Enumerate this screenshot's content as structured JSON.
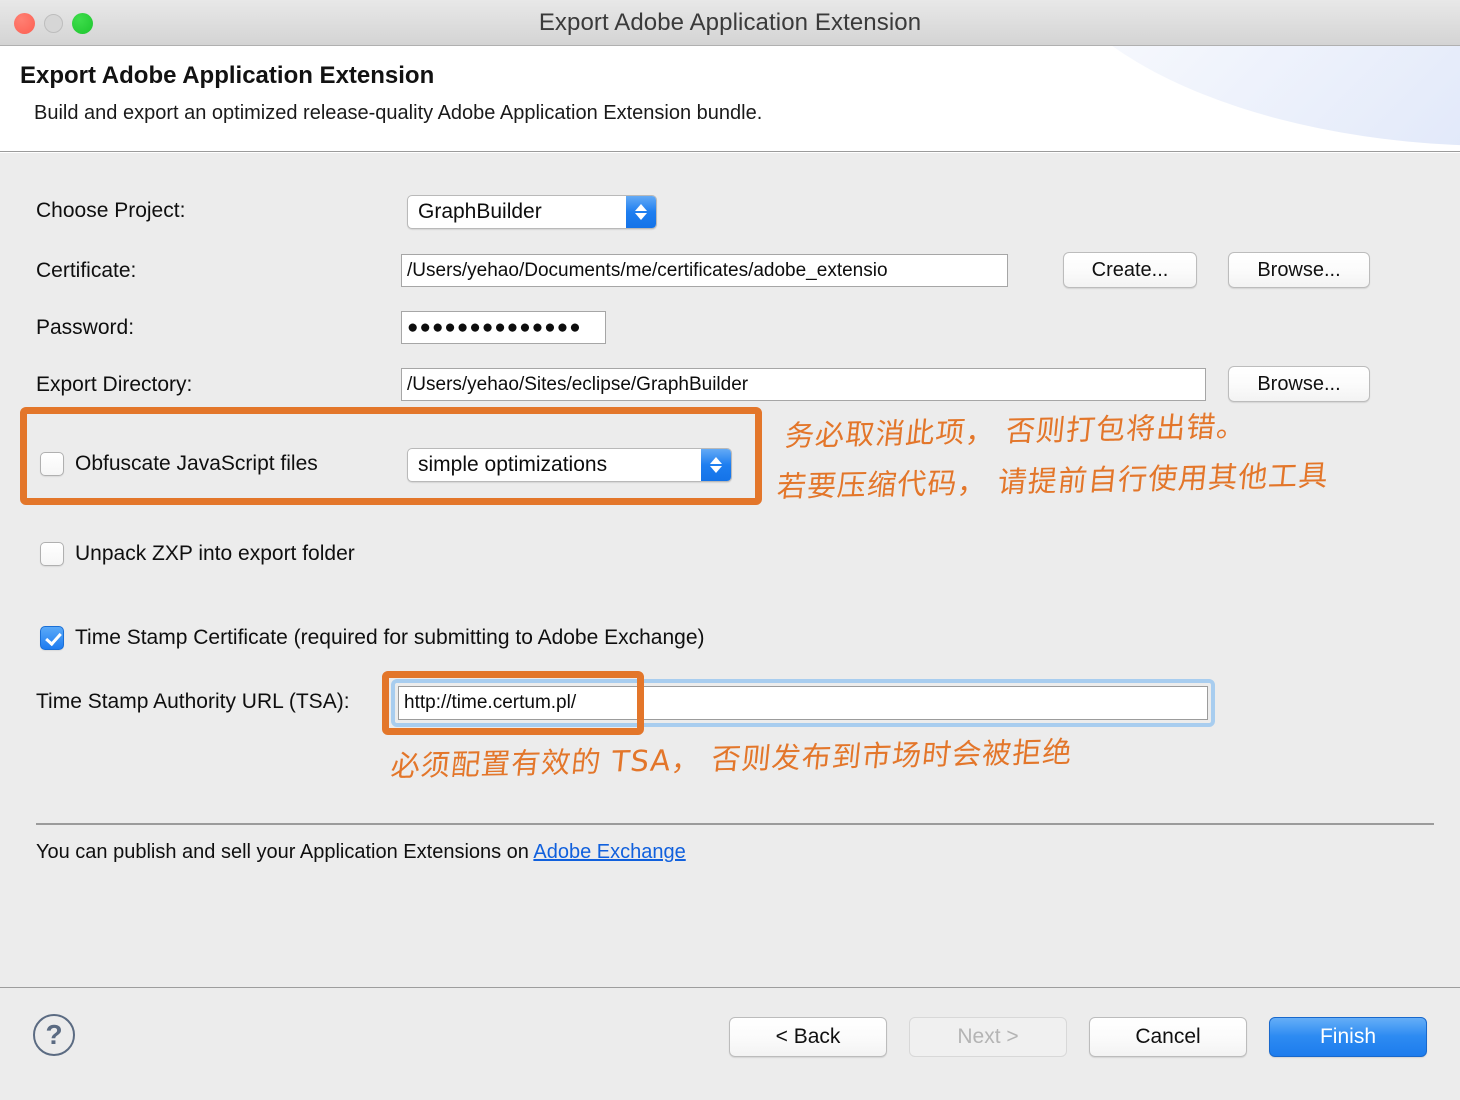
{
  "window": {
    "title": "Export Adobe Application Extension",
    "traffic_lights": [
      "close-button",
      "minimize-button",
      "zoom-button"
    ]
  },
  "header": {
    "title": "Export Adobe Application Extension",
    "description": "Build and export an optimized release-quality Adobe Application Extension bundle."
  },
  "form": {
    "project": {
      "label": "Choose Project:",
      "value": "GraphBuilder"
    },
    "certificate": {
      "label": "Certificate:",
      "value": "/Users/yehao/Documents/me/certificates/adobe_extensio",
      "create_label": "Create...",
      "browse_label": "Browse..."
    },
    "password": {
      "label": "Password:",
      "value": "●●●●●●●●●●●●●●"
    },
    "export_directory": {
      "label": "Export Directory:",
      "value": "/Users/yehao/Sites/eclipse/GraphBuilder",
      "browse_label": "Browse..."
    },
    "obfuscate": {
      "label": "Obfuscate JavaScript files",
      "checked": false,
      "option": "simple optimizations"
    },
    "unpack": {
      "label": "Unpack ZXP into export folder",
      "checked": false
    },
    "timestamp": {
      "label": "Time Stamp Certificate (required for submitting to Adobe Exchange)",
      "checked": true
    },
    "tsa": {
      "label": "Time Stamp Authority URL (TSA):",
      "value": "http://time.certum.pl/"
    }
  },
  "footnote": {
    "text": "You can publish and sell your Application Extensions on ",
    "link_text": "Adobe Exchange"
  },
  "annotations": {
    "color": "#e3762a",
    "obfuscate_note_line1": "务必取消此项， 否则打包将出错。",
    "obfuscate_note_line2": "若要压缩代码， 请提前自行使用其他工具",
    "tsa_note": "必须配置有效的 TSA， 否则发布到市场时会被拒绝"
  },
  "footer": {
    "help_glyph": "?",
    "back_label": "< Back",
    "next_label": "Next >",
    "cancel_label": "Cancel",
    "finish_label": "Finish"
  }
}
